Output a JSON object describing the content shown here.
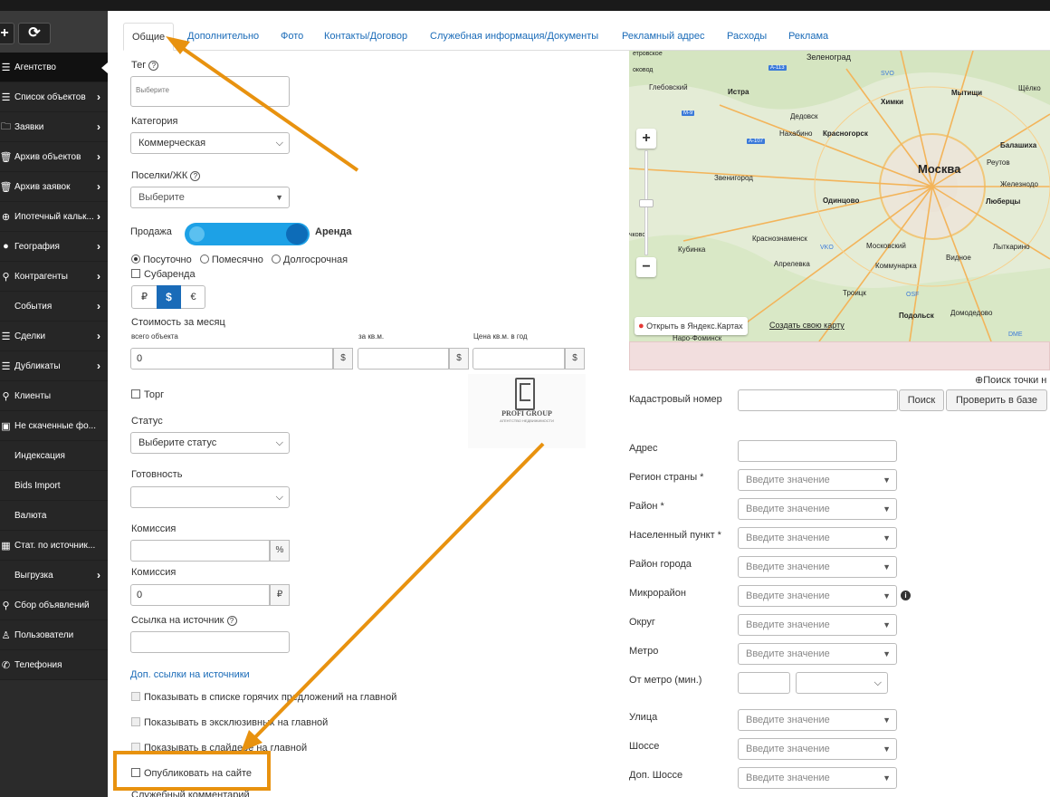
{
  "sidebar": {
    "items": [
      {
        "label": "Агентство",
        "icon": "list-icon",
        "glyph": "☰",
        "chevron": false,
        "active": true
      },
      {
        "label": "Список объектов",
        "icon": "list-icon",
        "glyph": "☰",
        "chevron": true
      },
      {
        "label": "Заявки",
        "icon": "folder-icon",
        "glyph": "🗀",
        "chevron": true
      },
      {
        "label": "Архив объектов",
        "icon": "trash-icon",
        "glyph": "🗑",
        "chevron": true
      },
      {
        "label": "Архив заявок",
        "icon": "trash-icon",
        "glyph": "🗑",
        "chevron": true
      },
      {
        "label": "Ипотечный кальк...",
        "icon": "circle-arrow-icon",
        "glyph": "⊕",
        "chevron": true
      },
      {
        "label": "География",
        "icon": "globe-icon",
        "glyph": "●",
        "chevron": true
      },
      {
        "label": "Контрагенты",
        "icon": "search-icon",
        "glyph": "⚲",
        "chevron": true
      },
      {
        "label": "События",
        "icon": "",
        "glyph": "",
        "chevron": true
      },
      {
        "label": "Сделки",
        "icon": "list-icon",
        "glyph": "☰",
        "chevron": true
      },
      {
        "label": "Дубликаты",
        "icon": "list-icon",
        "glyph": "☰",
        "chevron": true
      },
      {
        "label": "Клиенты",
        "icon": "search-icon",
        "glyph": "⚲",
        "chevron": false
      },
      {
        "label": "Не скаченные фо...",
        "icon": "image-icon",
        "glyph": "▣",
        "chevron": false
      },
      {
        "label": "Индексация",
        "icon": "",
        "glyph": "",
        "chevron": false
      },
      {
        "label": "Bids Import",
        "icon": "",
        "glyph": "",
        "chevron": false
      },
      {
        "label": "Валюта",
        "icon": "",
        "glyph": "",
        "chevron": false
      },
      {
        "label": "Стат. по источник...",
        "icon": "grid-icon",
        "glyph": "▦",
        "chevron": false
      },
      {
        "label": "Выгрузка",
        "icon": "",
        "glyph": "",
        "chevron": true
      },
      {
        "label": "Сбор объявлений",
        "icon": "search-icon",
        "glyph": "⚲",
        "chevron": false
      },
      {
        "label": "Пользователи",
        "icon": "user-icon",
        "glyph": "♙",
        "chevron": false
      },
      {
        "label": "Телефония",
        "icon": "phone-icon",
        "glyph": "✆",
        "chevron": false
      }
    ]
  },
  "tabs": [
    "Общие",
    "Дополнительно",
    "Фото",
    "Контакты/Договор",
    "Служебная информация/Документы",
    "Рекламный адрес",
    "Расходы",
    "Реклама"
  ],
  "form": {
    "tag_label": "Тег",
    "tag_placeholder": "Выберите",
    "category_label": "Категория",
    "category_value": "Коммерческая",
    "settlement_label": "Поселки/ЖК",
    "settlement_placeholder": "Выберите",
    "sale_label": "Продажа",
    "rent_label": "Аренда",
    "rent_period": [
      "Посуточно",
      "Помесячно",
      "Долгосрочная"
    ],
    "sublease": "Субаренда",
    "currencies": [
      "₽",
      "$",
      "€"
    ],
    "price_title": "Стоимость за месяц",
    "price_total_label": "всего объекта",
    "price_sqm_label": "за кв.м.",
    "price_year_label": "Цена кв.м. в год",
    "price_total_value": "0",
    "currency_suffix": "$",
    "bargain": "Торг",
    "status_label": "Статус",
    "status_placeholder": "Выберите статус",
    "readiness_label": "Готовность",
    "commission_label": "Комиссия",
    "commission_pct": "%",
    "commission2_label": "Комиссия",
    "commission2_value": "0",
    "commission2_suffix": "₽",
    "source_label": "Ссылка на источник",
    "extra_links": "Доп. ссылки на источники",
    "show_hot": "Показывать в списке горячих предложений на главной",
    "show_exclusive": "Показывать в эксклюзивных на главной",
    "show_slider": "Показывать в слайдере на главной",
    "publish": "Опубликовать на сайте",
    "service_comment": "Служебный комментарий"
  },
  "logo": {
    "name": "PROFI GROUP",
    "tagline": "АГЕНТСТВО НЕДВИЖИМОСТИ"
  },
  "map": {
    "cities": [
      {
        "name": "Москва",
        "big": true
      },
      {
        "name": "Зеленоград"
      },
      {
        "name": "Истра"
      },
      {
        "name": "Химки"
      },
      {
        "name": "Мытищи"
      },
      {
        "name": "Щёлко"
      },
      {
        "name": "Глебовский"
      },
      {
        "name": "Дедовск"
      },
      {
        "name": "Нахабино"
      },
      {
        "name": "Красногорск"
      },
      {
        "name": "Балашиха"
      },
      {
        "name": "Реутов"
      },
      {
        "name": "Железнодо"
      },
      {
        "name": "Люберцы"
      },
      {
        "name": "Звенигород"
      },
      {
        "name": "Одинцово"
      },
      {
        "name": "Краснознаменск"
      },
      {
        "name": "Московский"
      },
      {
        "name": "Кубинка"
      },
      {
        "name": "Апрелевка"
      },
      {
        "name": "Коммунарка"
      },
      {
        "name": "Видное"
      },
      {
        "name": "Лыткарино"
      },
      {
        "name": "Троицк"
      },
      {
        "name": "Подольск"
      },
      {
        "name": "Домодедово"
      },
      {
        "name": "Наро-Фоминск"
      },
      {
        "name": "етровское"
      },
      {
        "name": "оковод"
      },
      {
        "name": "чково"
      }
    ],
    "roads": [
      "A-113",
      "M-9",
      "A-107"
    ],
    "airports": [
      "SVO",
      "VKO",
      "OSF",
      "DME"
    ],
    "open_link": "Открыть в Яндекс.Картах",
    "create_link": "Создать свою карту",
    "zoom_in": "+",
    "zoom_out": "−"
  },
  "right": {
    "search_point": "Поиск точки н",
    "cadastral_label": "Кадастровый номер",
    "search_button": "Поиск",
    "check_button": "Проверить в базе",
    "address_label": "Адрес",
    "region_label": "Регион страны *",
    "district_label": "Район *",
    "locality_label": "Населенный пункт *",
    "city_district_label": "Район города",
    "microdistrict_label": "Микрорайон",
    "okrug_label": "Округ",
    "metro_label": "Метро",
    "from_metro_label": "От метро (мин.)",
    "street_label": "Улица",
    "highway_label": "Шоссе",
    "extra_highway_label": "Доп. Шоссе",
    "placeholder": "Введите значение"
  },
  "colors": {
    "accent": "#1a6bb8",
    "arrow": "#e8920f",
    "toggle": "#1da1e6",
    "toggle_knob": "#0d6cb8",
    "sidebar": "#2b2b2b"
  }
}
